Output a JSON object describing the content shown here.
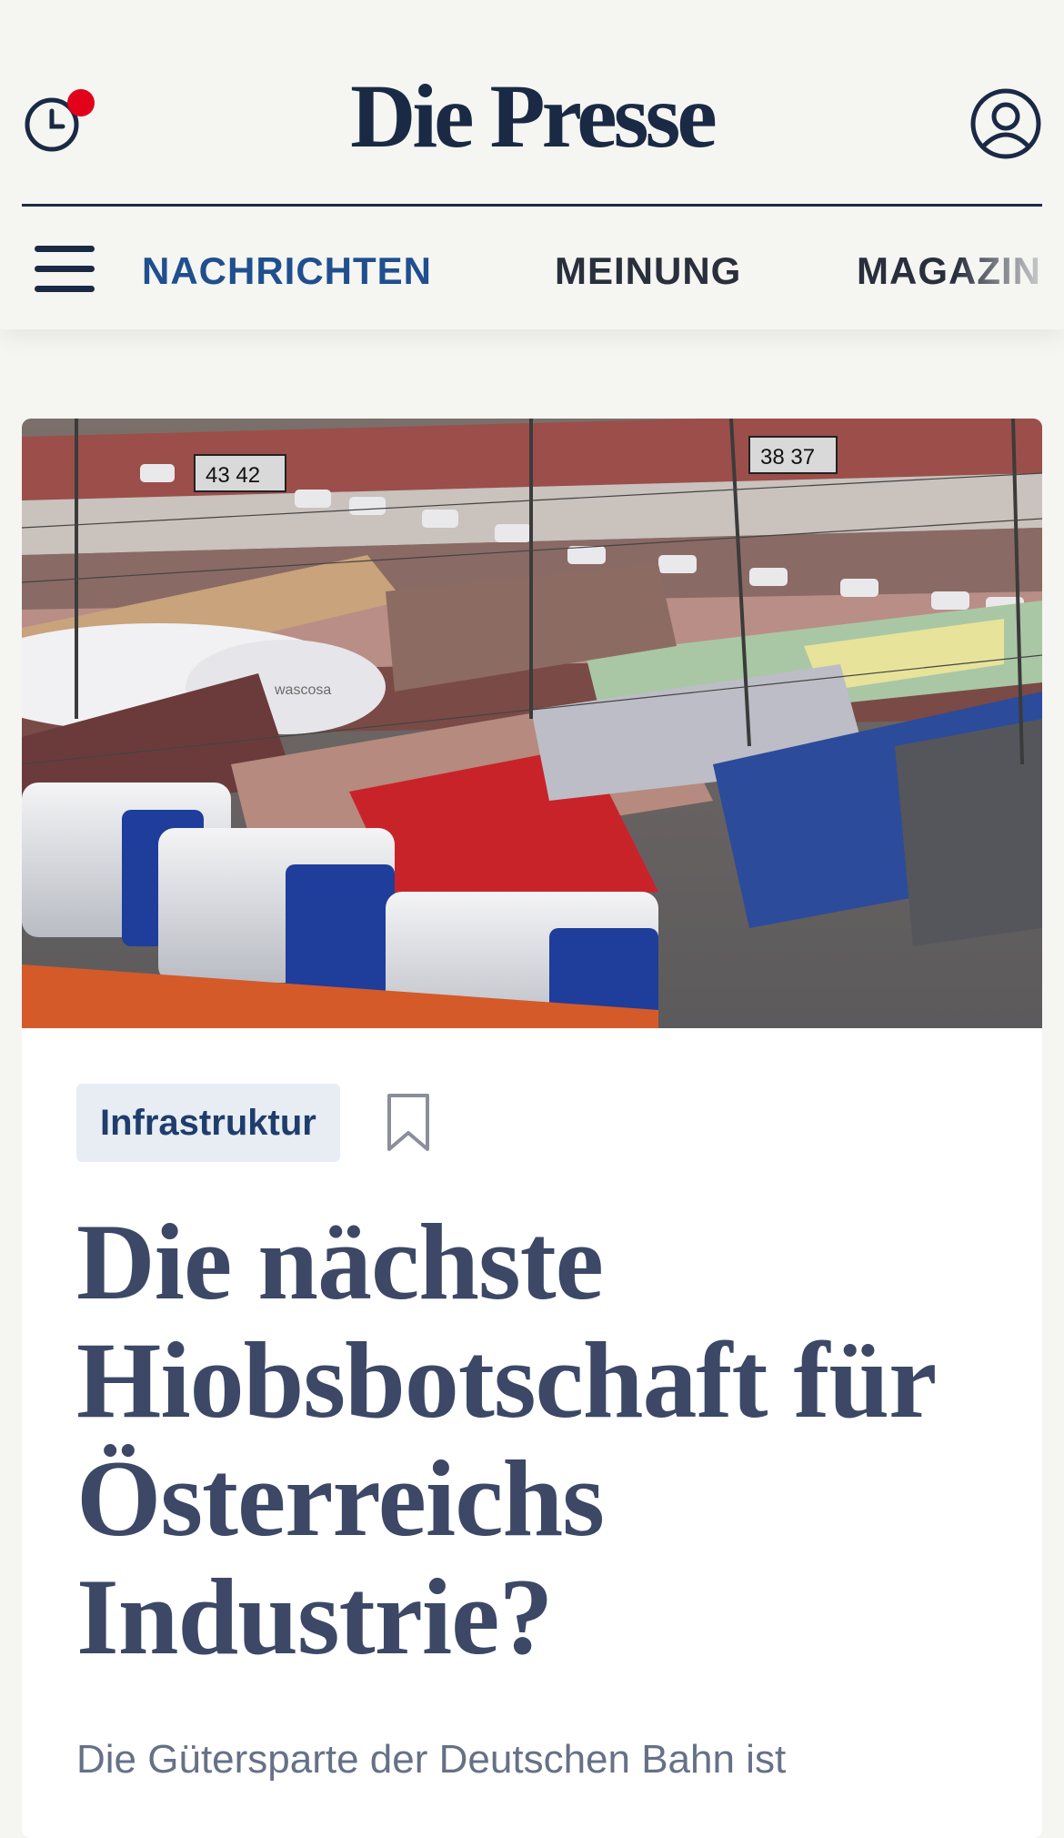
{
  "header": {
    "logo": "Die Presse",
    "icons": {
      "history": "clock-history-icon",
      "account": "user-account-icon",
      "menu": "hamburger-menu-icon",
      "bookmark": "bookmark-icon"
    },
    "notification_color": "#e3001b"
  },
  "nav": {
    "items": [
      {
        "label": "NACHRICHTEN",
        "active": true
      },
      {
        "label": "MEINUNG",
        "active": false
      },
      {
        "label": "MAGAZIN",
        "active": false
      }
    ]
  },
  "article": {
    "image_description": "Güterzüge mit Tankcontainern und Waggons auf einem Rangierbahnhof",
    "tag": "Infrastruktur",
    "headline": "Die nächste Hiobsbotschaft für Österreichs Industrie?",
    "lead": "Die Gütersparte der Deutschen Bahn ist"
  },
  "colors": {
    "brand_navy": "#1a2a45",
    "nav_active": "#1f4f8f",
    "nav_inactive": "#2a2f3c",
    "headline": "#3c4866",
    "tag_bg": "#e8edf4"
  }
}
